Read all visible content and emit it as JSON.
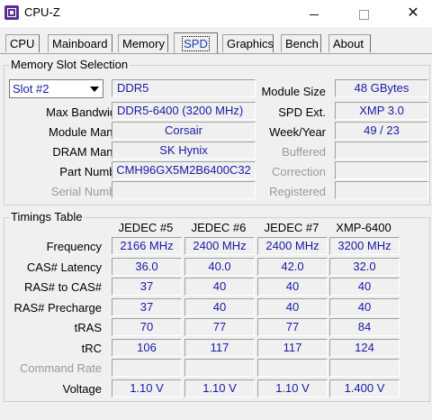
{
  "window": {
    "title": "CPU-Z"
  },
  "tabs": [
    "CPU",
    "Mainboard",
    "Memory",
    "SPD",
    "Graphics",
    "Bench",
    "About"
  ],
  "memory_slot": {
    "group_title": "Memory Slot Selection",
    "slot_selected": "Slot #2",
    "type": "DDR5",
    "labels": {
      "max_bandwidth": "Max Bandwidth",
      "module_manuf": "Module Manuf.",
      "dram_manuf": "DRAM Manuf.",
      "part_number": "Part Number",
      "serial_number": "Serial Number",
      "module_size": "Module Size",
      "spd_ext": "SPD Ext.",
      "week_year": "Week/Year",
      "buffered": "Buffered",
      "correction": "Correction",
      "registered": "Registered"
    },
    "values": {
      "max_bandwidth": "DDR5-6400 (3200 MHz)",
      "module_manuf": "Corsair",
      "dram_manuf": "SK Hynix",
      "part_number": "CMH96GX5M2B6400C32",
      "serial_number": "",
      "module_size": "48 GBytes",
      "spd_ext": "XMP 3.0",
      "week_year": "49 / 23",
      "buffered": "",
      "correction": "",
      "registered": ""
    }
  },
  "timings": {
    "group_title": "Timings Table",
    "columns": [
      "JEDEC #5",
      "JEDEC #6",
      "JEDEC #7",
      "XMP-6400"
    ],
    "rows": [
      {
        "label": "Frequency",
        "values": [
          "2166 MHz",
          "2400 MHz",
          "2400 MHz",
          "3200 MHz"
        ]
      },
      {
        "label": "CAS# Latency",
        "values": [
          "36.0",
          "40.0",
          "42.0",
          "32.0"
        ]
      },
      {
        "label": "RAS# to CAS#",
        "values": [
          "37",
          "40",
          "40",
          "40"
        ]
      },
      {
        "label": "RAS# Precharge",
        "values": [
          "37",
          "40",
          "40",
          "40"
        ]
      },
      {
        "label": "tRAS",
        "values": [
          "70",
          "77",
          "77",
          "84"
        ]
      },
      {
        "label": "tRC",
        "values": [
          "106",
          "117",
          "117",
          "124"
        ]
      },
      {
        "label": "Command Rate",
        "values": [
          "",
          "",
          "",
          ""
        ]
      },
      {
        "label": "Voltage",
        "values": [
          "1.10 V",
          "1.10 V",
          "1.10 V",
          "1.400 V"
        ]
      }
    ]
  }
}
